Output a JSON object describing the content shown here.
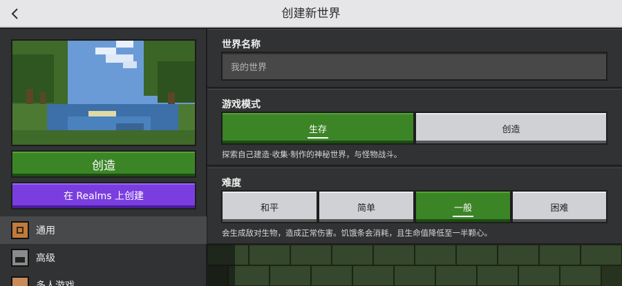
{
  "header": {
    "title": "创建新世界",
    "back_icon": "chevron-left-icon"
  },
  "left": {
    "create_button": "创造",
    "realms_button": "在 Realms 上创建",
    "nav": [
      {
        "label": "通用",
        "icon": "commandblock-icon",
        "active": true
      },
      {
        "label": "高级",
        "icon": "furnace-icon",
        "active": false
      },
      {
        "label": "多人游戏",
        "icon": "players-icon",
        "active": false
      }
    ]
  },
  "main": {
    "world_name": {
      "label": "世界名称",
      "placeholder": "我的世界"
    },
    "game_mode": {
      "label": "游戏模式",
      "options": [
        "生存",
        "创造"
      ],
      "selected": "生存",
      "description": "探索自己建造·收集·制作的神秘世界，与怪物战斗。"
    },
    "difficulty": {
      "label": "难度",
      "options": [
        "和平",
        "简单",
        "一般",
        "困难"
      ],
      "selected": "一般",
      "description": "会生成敌对生物，造成正常伤害。饥饿条会消耗，且生命值降低至一半颗心。"
    }
  },
  "colors": {
    "green": "#3c8527",
    "purple": "#7a3ee0",
    "panel": "#313233"
  }
}
